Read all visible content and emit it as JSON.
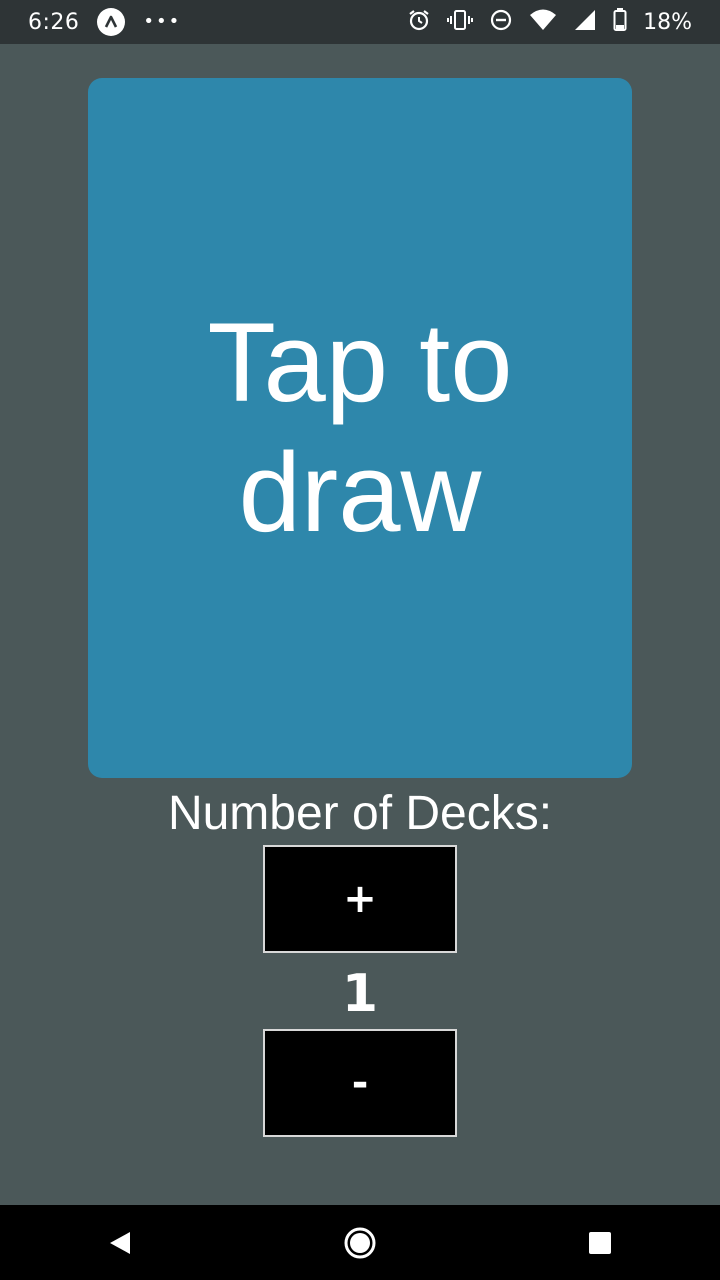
{
  "status_bar": {
    "time": "6:26",
    "overflow_dots": "•••",
    "battery_percent": "18%",
    "icons": [
      "app-notification-icon",
      "alarm-icon",
      "vibrate-icon",
      "do-not-disturb-icon",
      "wifi-icon",
      "cell-signal-icon",
      "battery-icon"
    ]
  },
  "card": {
    "label": "Tap to draw",
    "color": "#2e87ab"
  },
  "decks": {
    "label": "Number of Decks:",
    "increment_label": "+",
    "count": "1",
    "decrement_label": "-"
  },
  "nav_bar": {
    "icons": [
      "back-icon",
      "home-icon",
      "recents-icon"
    ]
  },
  "colors": {
    "background": "#4b5859",
    "status_bar": "#2e3436",
    "button_bg": "#000000",
    "text": "#ffffff"
  }
}
